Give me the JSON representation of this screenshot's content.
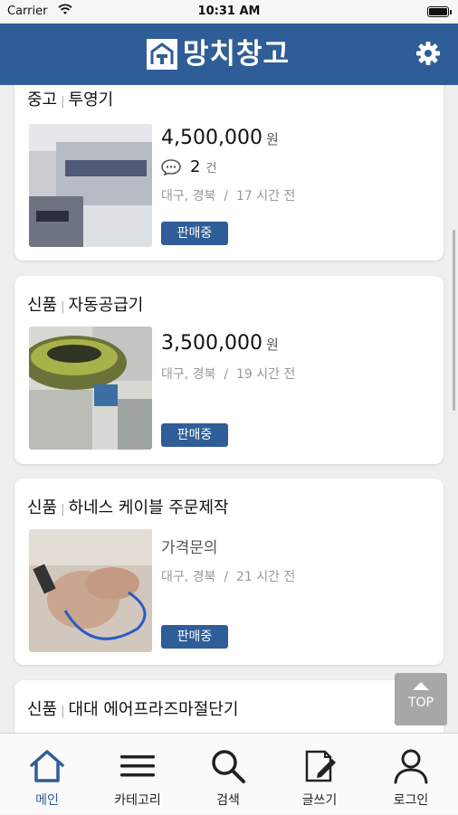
{
  "status_bar": {
    "carrier": "Carrier",
    "time": "10:31 AM"
  },
  "header": {
    "logo_text": "망치창고"
  },
  "accent_color": "#2f5d97",
  "listings": [
    {
      "condition": "중고",
      "name": "투영기",
      "price": "4,500,000",
      "price_unit": "원",
      "comments_count": "2",
      "comments_unit": "건",
      "location": "대구, 경북",
      "time_ago": "17 시간 전",
      "status": "판매중"
    },
    {
      "condition": "신품",
      "name": "자동공급기",
      "price": "3,500,000",
      "price_unit": "원",
      "location": "대구, 경북",
      "time_ago": "19 시간 전",
      "status": "판매중"
    },
    {
      "condition": "신품",
      "name": "하네스 케이블 주문제작",
      "price_text": "가격문의",
      "location": "대구, 경북",
      "time_ago": "21 시간 전",
      "status": "판매중"
    },
    {
      "condition": "신품",
      "name": "대대 에어프라즈마절단기"
    }
  ],
  "meta_separator": "/",
  "top_button": {
    "label": "TOP"
  },
  "tabbar": [
    {
      "label": "메인",
      "icon": "home-icon",
      "active": true
    },
    {
      "label": "카테고리",
      "icon": "menu-icon"
    },
    {
      "label": "검색",
      "icon": "search-icon"
    },
    {
      "label": "글쓰기",
      "icon": "write-icon"
    },
    {
      "label": "로그인",
      "icon": "user-icon"
    }
  ]
}
